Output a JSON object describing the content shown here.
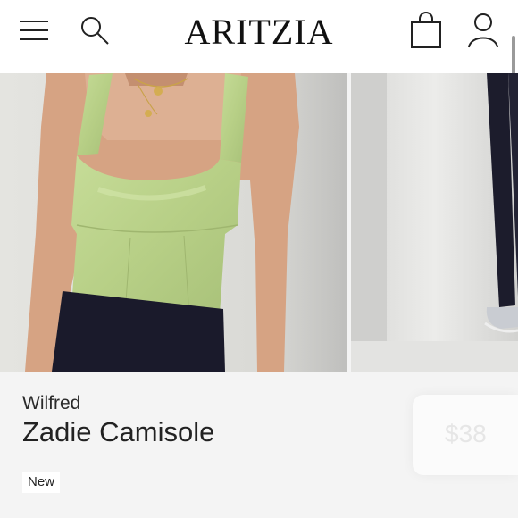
{
  "header": {
    "logo": "ARITZIA",
    "icons": [
      "menu-icon",
      "search-icon",
      "shopping-bag-icon",
      "account-icon"
    ]
  },
  "product": {
    "brand": "Wilfred",
    "name": "Zadie Camisole",
    "badge": "New",
    "floating_price": "$38"
  },
  "colors": {
    "header_bg": "#ffffff",
    "page_bg": "#f4f4f4",
    "top_color": "#b9d28a",
    "pants_color": "#1a1a2b"
  }
}
